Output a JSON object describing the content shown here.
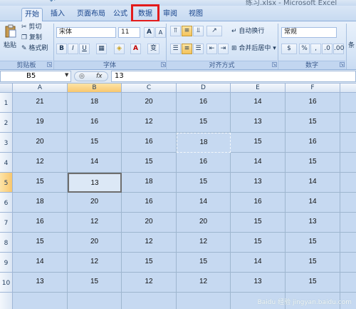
{
  "window": {
    "title": "练习.xlsx - Microsoft Excel"
  },
  "tabs": [
    {
      "label": "开始",
      "active": true
    },
    {
      "label": "插入"
    },
    {
      "label": "页面布局"
    },
    {
      "label": "公式"
    },
    {
      "label": "数据",
      "highlighted": true
    },
    {
      "label": "审阅"
    },
    {
      "label": "视图"
    }
  ],
  "ribbon": {
    "clipboard": {
      "paste": "粘贴",
      "cut": "剪切",
      "copy": "复制",
      "format_painter": "格式刷",
      "label": "剪贴板"
    },
    "font": {
      "font_name": "宋体",
      "font_size": "11",
      "bold": "B",
      "italic": "I",
      "underline": "U",
      "grow": "A",
      "shrink": "A",
      "color_letter": "A",
      "phonetic": "变",
      "label": "字体"
    },
    "alignment": {
      "wrap_text": "自动换行",
      "merge_center": "合并后居中",
      "label": "对齐方式"
    },
    "number": {
      "format": "常规",
      "percent": "%",
      "comma": ",",
      "label": "数字"
    },
    "styles": {
      "label": "条"
    }
  },
  "formula_bar": {
    "name_box": "B5",
    "fx": "fx",
    "value": "13"
  },
  "grid": {
    "columns": [
      "A",
      "B",
      "C",
      "D",
      "E",
      "F"
    ],
    "selected_column": "B",
    "rows": [
      "1",
      "2",
      "3",
      "4",
      "5",
      "6",
      "7",
      "8",
      "9",
      "10"
    ],
    "selected_row": "5",
    "active_cell": "B5",
    "copy_marquee_cell": "D3",
    "values": [
      [
        "21",
        "18",
        "20",
        "16",
        "14",
        "16"
      ],
      [
        "19",
        "16",
        "12",
        "15",
        "13",
        "15"
      ],
      [
        "20",
        "15",
        "16",
        "18",
        "15",
        "16"
      ],
      [
        "12",
        "14",
        "15",
        "16",
        "14",
        "15"
      ],
      [
        "15",
        "13",
        "18",
        "15",
        "13",
        "14"
      ],
      [
        "18",
        "20",
        "16",
        "14",
        "16",
        "14"
      ],
      [
        "16",
        "12",
        "20",
        "20",
        "15",
        "13"
      ],
      [
        "15",
        "20",
        "12",
        "12",
        "15",
        "15"
      ],
      [
        "14",
        "12",
        "15",
        "15",
        "14",
        "15"
      ],
      [
        "13",
        "15",
        "12",
        "12",
        "13",
        "15"
      ]
    ]
  },
  "watermark": "Baidu 经验 jingyan.baidu.com"
}
